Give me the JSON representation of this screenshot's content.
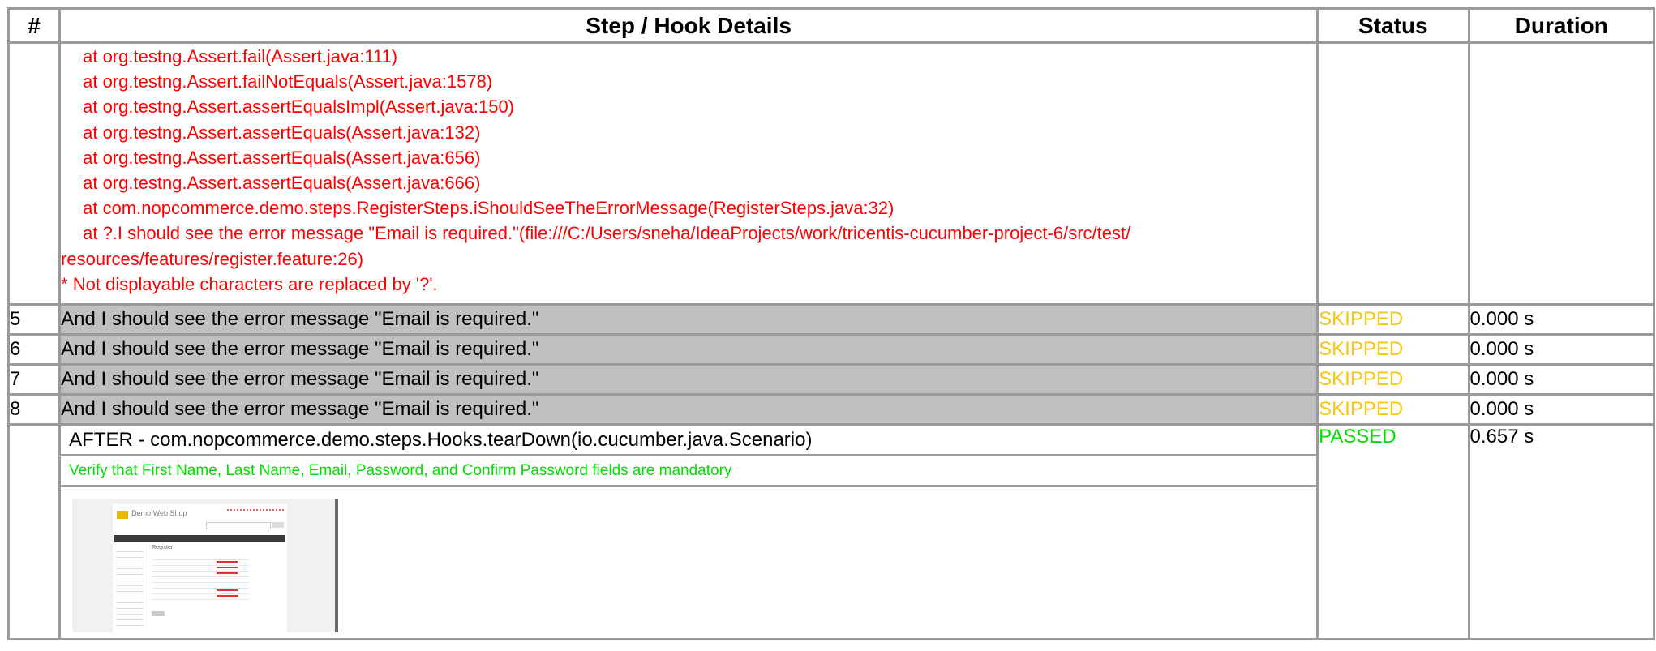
{
  "headers": {
    "num": "#",
    "step": "Step / Hook Details",
    "status": "Status",
    "duration": "Duration"
  },
  "stack_trace": [
    "at org.testng.Assert.fail(Assert.java:111)",
    "at org.testng.Assert.failNotEquals(Assert.java:1578)",
    "at org.testng.Assert.assertEqualsImpl(Assert.java:150)",
    "at org.testng.Assert.assertEquals(Assert.java:132)",
    "at org.testng.Assert.assertEquals(Assert.java:656)",
    "at org.testng.Assert.assertEquals(Assert.java:666)",
    "at com.nopcommerce.demo.steps.RegisterSteps.iShouldSeeTheErrorMessage(RegisterSteps.java:32)",
    "at ?.I should see the error message \"Email is required.\"(file:///C:/Users/sneha/IdeaProjects/work/tricentis-cucumber-project-6/src/test/",
    "resources/features/register.feature:26)",
    "* Not displayable characters are replaced by '?'."
  ],
  "steps": [
    {
      "num": "5",
      "text": "And I should see the error message \"Email is required.\"",
      "status": "SKIPPED",
      "duration": "0.000 s"
    },
    {
      "num": "6",
      "text": "And I should see the error message \"Email is required.\"",
      "status": "SKIPPED",
      "duration": "0.000 s"
    },
    {
      "num": "7",
      "text": "And I should see the error message \"Email is required.\"",
      "status": "SKIPPED",
      "duration": "0.000 s"
    },
    {
      "num": "8",
      "text": "And I should see the error message \"Email is required.\"",
      "status": "SKIPPED",
      "duration": "0.000 s"
    }
  ],
  "after_hook": {
    "text": "AFTER - com.nopcommerce.demo.steps.Hooks.tearDown(io.cucumber.java.Scenario)",
    "status": "PASSED",
    "duration": "0.657 s",
    "scenario_note": "Verify that First Name, Last Name, Email, Password, and Confirm Password fields are mandatory",
    "screenshot": {
      "brand": "Demo Web Shop",
      "page_title": "Register"
    }
  },
  "colors": {
    "skipped": "#f5c518",
    "passed": "#00e000",
    "error": "#ff0000",
    "step_bg": "#c0c0c0",
    "border": "#9a9a9a"
  }
}
